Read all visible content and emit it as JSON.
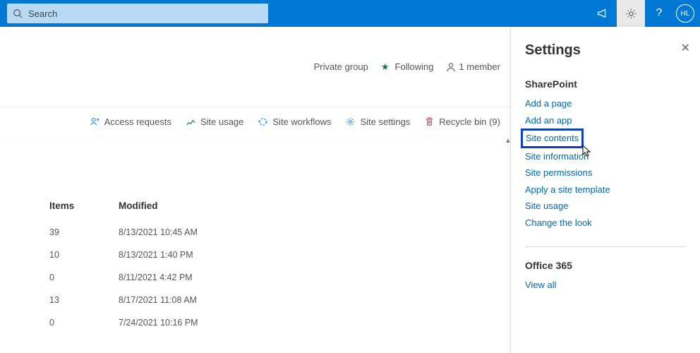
{
  "search": {
    "placeholder": "Search"
  },
  "avatar": {
    "initials": "HL"
  },
  "siteHeader": {
    "group": "Private group",
    "following": "Following",
    "members": "1 member"
  },
  "commands": {
    "access": "Access requests",
    "usage": "Site usage",
    "workflows": "Site workflows",
    "settings": "Site settings",
    "recycle": "Recycle bin (9)"
  },
  "columns": {
    "items": "Items",
    "modified": "Modified"
  },
  "rows": [
    {
      "items": "39",
      "modified": "8/13/2021 10:45 AM"
    },
    {
      "items": "10",
      "modified": "8/13/2021 1:40 PM"
    },
    {
      "items": "0",
      "modified": "8/11/2021 4:42 PM"
    },
    {
      "items": "13",
      "modified": "8/17/2021 11:08 AM"
    },
    {
      "items": "0",
      "modified": "7/24/2021 10:16 PM"
    }
  ],
  "panel": {
    "title": "Settings",
    "sharepoint": {
      "heading": "SharePoint",
      "links": [
        "Add a page",
        "Add an app",
        "Site contents",
        "Site information",
        "Site permissions",
        "Apply a site template",
        "Site usage",
        "Change the look"
      ],
      "highlightedIndex": 2
    },
    "office": {
      "heading": "Office 365",
      "viewAll": "View all"
    }
  }
}
